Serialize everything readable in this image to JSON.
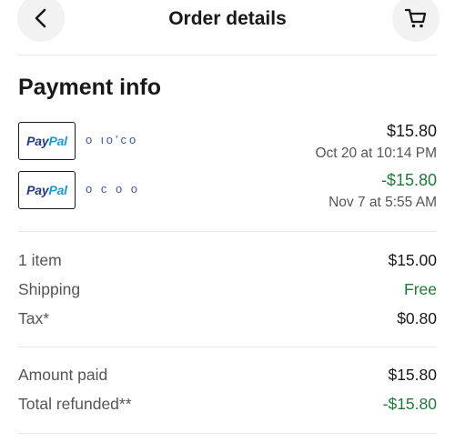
{
  "header": {
    "title": "Order details"
  },
  "payment_info": {
    "title": "Payment info",
    "transactions": [
      {
        "method_left": "Pay",
        "method_right": "Pal",
        "account_masked": "o  ιo'cο",
        "amount": "$15.80",
        "datetime": "Oct 20 at 10:14 PM"
      },
      {
        "method_left": "Pay",
        "method_right": "Pal",
        "account_masked": "o     c o o",
        "amount": "-$15.80",
        "datetime": "Nov 7 at 5:55 AM"
      }
    ]
  },
  "summary": {
    "items_label": "1 item",
    "items_value": "$15.00",
    "shipping_label": "Shipping",
    "shipping_value": "Free",
    "tax_label": "Tax*",
    "tax_value": "$0.80"
  },
  "totals": {
    "paid_label": "Amount paid",
    "paid_value": "$15.80",
    "refunded_label": "Total refunded**",
    "refunded_value": "-$15.80"
  },
  "colors": {
    "refund_green": "#1f7a3a",
    "paypal_dark": "#253b80",
    "paypal_light": "#179bd7"
  }
}
